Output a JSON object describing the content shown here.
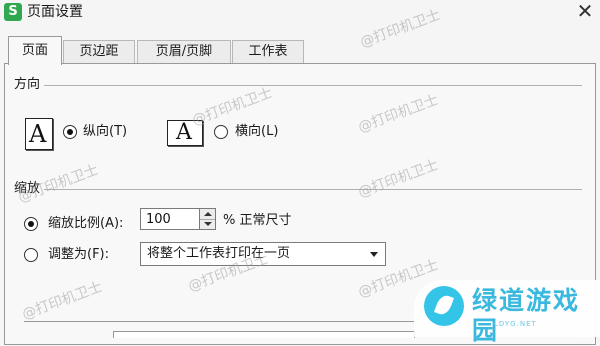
{
  "window": {
    "app_icon": "S",
    "title": "页面设置",
    "close_glyph": "✕"
  },
  "tabs": [
    {
      "label": "页面",
      "active": true
    },
    {
      "label": "页边距",
      "active": false
    },
    {
      "label": "页眉/页脚",
      "active": false
    },
    {
      "label": "工作表",
      "active": false
    }
  ],
  "orientation": {
    "title": "方向",
    "portrait": {
      "icon_letter": "A",
      "label": "纵向(T)",
      "selected": true
    },
    "landscape": {
      "icon_letter": "A",
      "label": "横向(L)",
      "selected": false
    }
  },
  "scaling": {
    "title": "缩放",
    "scale_option": {
      "label": "缩放比例(A):",
      "selected": true
    },
    "scale_value": "100",
    "scale_suffix": "% 正常尺寸",
    "fit_option": {
      "label": "调整为(F):",
      "selected": false
    },
    "fit_value": "将整个工作表打印在一页"
  },
  "watermark_text": "@打印机卫士",
  "brand": {
    "name": "绿道游戏园",
    "sub": "LDYG.NET"
  }
}
